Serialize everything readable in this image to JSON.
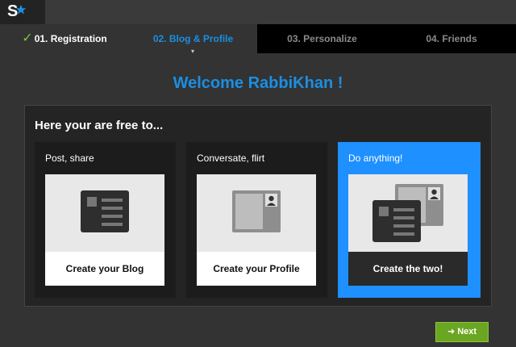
{
  "app": {
    "logo_letter": "S"
  },
  "steps": [
    {
      "label": "01. Registration",
      "state": "done"
    },
    {
      "label": "02. Blog & Profile",
      "state": "active"
    },
    {
      "label": "03. Personalize",
      "state": "upcoming"
    },
    {
      "label": "04. Friends",
      "state": "upcoming"
    }
  ],
  "welcome": "Welcome RabbiKhan !",
  "panel": {
    "title": "Here your are free to...",
    "cards": [
      {
        "heading": "Post, share",
        "button": "Create your Blog",
        "icon": "blog-card-icon"
      },
      {
        "heading": "Conversate, flirt",
        "button": "Create your Profile",
        "icon": "profile-card-icon"
      },
      {
        "heading": "Do anything!",
        "button": "Create the two!",
        "icon": "blog-and-profile-icon",
        "selected": true
      }
    ]
  },
  "next_button": "Next",
  "colors": {
    "accent": "#1a8fe3",
    "selected_card": "#1e90ff",
    "next": "#6aa621",
    "check": "#7fc241"
  }
}
